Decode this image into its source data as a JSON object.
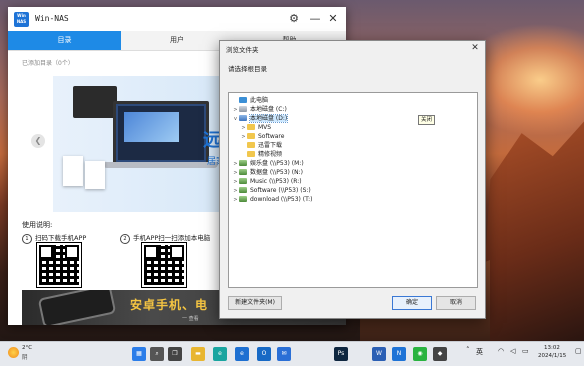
{
  "nas_window": {
    "logo_text": "Win NAS",
    "app_name": "Win-NAS",
    "tabs": [
      "目录",
      "用户",
      "帮助"
    ],
    "added_dirs_label": "已添加目录（0个）",
    "banner": {
      "headline": "远程",
      "subline": "居家"
    },
    "usage": {
      "title": "使用说明:",
      "steps": [
        {
          "num": "1",
          "text": "扫码下载手机APP"
        },
        {
          "num": "2",
          "text": "手机APP扫一扫添加本电脑"
        }
      ]
    },
    "ad": {
      "headline": "安卓手机、电",
      "small": "一 查看"
    }
  },
  "dialog": {
    "title": "浏览文件夹",
    "prompt": "请选择根目录",
    "tree": [
      {
        "label": "此电脑",
        "icon": "computer-icon",
        "expander": ""
      },
      {
        "label": "本地磁盘 (C:)",
        "icon": "drive-icon",
        "expander": ">"
      },
      {
        "label": "本地磁盘 (D:)",
        "icon": "drive-icon",
        "expander": "v"
      },
      {
        "label": "MVS",
        "icon": "folder-icon",
        "expander": ">"
      },
      {
        "label": "Software",
        "icon": "folder-icon",
        "expander": ">"
      },
      {
        "label": "迅雷下载",
        "icon": "folder-icon",
        "expander": ""
      },
      {
        "label": "精修视频",
        "icon": "folder-icon",
        "expander": ""
      },
      {
        "label": "娱乐盘 (\\\\P53) (M:)",
        "icon": "network-drive-icon",
        "expander": ">"
      },
      {
        "label": "数据盘 (\\\\P53) (N:)",
        "icon": "network-drive-icon",
        "expander": ">"
      },
      {
        "label": "Music (\\\\P53) (R:)",
        "icon": "network-drive-icon",
        "expander": ">"
      },
      {
        "label": "Software (\\\\P53) (S:)",
        "icon": "network-drive-icon",
        "expander": ">"
      },
      {
        "label": "download (\\\\P53) (T:)",
        "icon": "network-drive-icon",
        "expander": ">"
      }
    ],
    "selected_index": 2,
    "tooltip": "关闭",
    "new_folder_btn": "新建文件夹(M)",
    "ok_btn": "确定",
    "cancel_btn": "取消"
  },
  "taskbar": {
    "weather_temp": "2°C",
    "weather_desc": "阴",
    "apps": [
      {
        "name": "windows-start-icon",
        "color": "#2b7de9",
        "glyph": "▦"
      },
      {
        "name": "search-icon",
        "color": "#555555",
        "glyph": "⌕"
      },
      {
        "name": "task-view-icon",
        "color": "#444444",
        "glyph": "❐"
      },
      {
        "name": "file-explorer-icon",
        "color": "#e8b631",
        "glyph": "▬"
      },
      {
        "name": "edge-browser-icon",
        "color": "#1aa5a0",
        "glyph": "e"
      },
      {
        "name": "edge-dev-icon",
        "color": "#1d6fd1",
        "glyph": "e"
      },
      {
        "name": "outlook-icon",
        "color": "#1769c5",
        "glyph": "O"
      },
      {
        "name": "mail-icon",
        "color": "#2a6fd6",
        "glyph": "✉"
      },
      {
        "name": "photoshop-icon",
        "color": "#0f2740",
        "glyph": "Ps"
      },
      {
        "name": "word-icon",
        "color": "#2b5fb4",
        "glyph": "W"
      },
      {
        "name": "win-nas-icon",
        "color": "#1e73d6",
        "glyph": "N"
      },
      {
        "name": "wechat-icon",
        "color": "#2ab340",
        "glyph": "◉"
      },
      {
        "name": "other-app-icon",
        "color": "#444444",
        "glyph": "◆"
      }
    ],
    "ime": "英",
    "time": "13:02",
    "date": "2024/1/15"
  }
}
